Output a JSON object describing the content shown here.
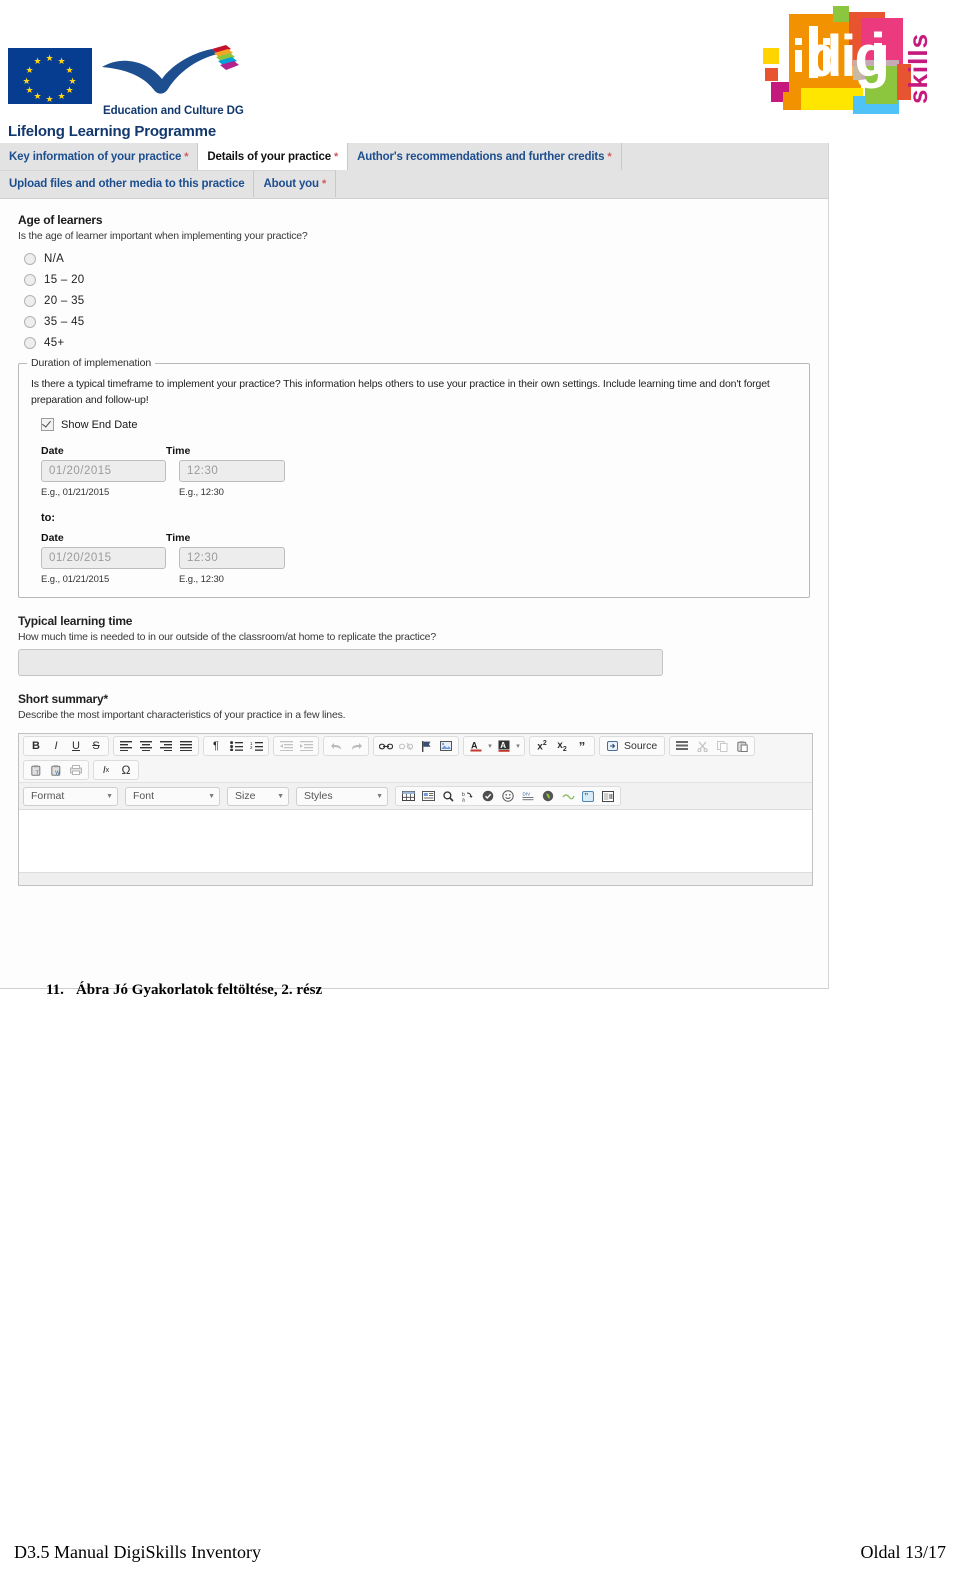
{
  "header": {
    "eu_caption": "Education and Culture DG",
    "llp_caption": "Lifelong Learning Programme",
    "logo_alt": "digi skills"
  },
  "tabs": {
    "row1": [
      {
        "label": "Key information of your practice",
        "required": "*",
        "active": false
      },
      {
        "label": "Details of your practice",
        "required": "*",
        "active": true
      },
      {
        "label": "Author's recommendations and further credits",
        "required": "*",
        "active": false
      }
    ],
    "row2": [
      {
        "label": "Upload files and other media to this practice",
        "required": "",
        "active": false
      },
      {
        "label": "About you",
        "required": "*",
        "active": false
      }
    ]
  },
  "age_section": {
    "title": "Age of learners",
    "help": "Is the age of learner important when implementing your practice?",
    "options": [
      {
        "label": "N/A",
        "selected": false
      },
      {
        "label": "15 – 20",
        "selected": false
      },
      {
        "label": "20 – 35",
        "selected": false
      },
      {
        "label": "35 – 45",
        "selected": false
      },
      {
        "label": "45+",
        "selected": false
      }
    ]
  },
  "duration_section": {
    "legend": "Duration of implemenation",
    "help": "Is there a typical timeframe to implement your practice? This information helps others to use your practice in their own settings. Include learning time and don't forget preparation and follow-up!",
    "show_end_date_label": "Show End Date",
    "show_end_date_checked": true,
    "start": {
      "date_label": "Date",
      "time_label": "Time",
      "date_value": "01/20/2015",
      "time_value": "12:30",
      "date_example": "E.g., 01/21/2015",
      "time_example": "E.g., 12:30"
    },
    "to_label": "to:",
    "end": {
      "date_label": "Date",
      "time_label": "Time",
      "date_value": "01/20/2015",
      "time_value": "12:30",
      "date_example": "E.g., 01/21/2015",
      "time_example": "E.g., 12:30"
    }
  },
  "learning_time_section": {
    "title": "Typical learning time",
    "help": "How much time is needed to in our outside of the classroom/at home to replicate the practice?",
    "value": ""
  },
  "short_summary_section": {
    "title": "Short summary",
    "required": "*",
    "help": "Describe the most important characteristics of your practice in a few lines.",
    "editor_content": ""
  },
  "editor": {
    "row1_icons": [
      "bold-icon",
      "italic-icon",
      "underline-icon",
      "strikethrough-icon",
      "align-left-icon",
      "align-center-icon",
      "align-right-icon",
      "justify-icon",
      "text-direction-rtl-icon",
      "bulleted-list-icon",
      "numbered-list-icon",
      "outdent-icon",
      "indent-icon",
      "undo-icon",
      "redo-icon",
      "link-icon",
      "unlink-icon",
      "anchor-icon",
      "image-icon",
      "text-color-icon",
      "background-color-icon",
      "superscript-icon",
      "subscript-icon",
      "blockquote-icon"
    ],
    "source_label": "Source",
    "row1_tail_icons": [
      "show-blocks-icon",
      "cut-icon",
      "copy-icon",
      "paste-icon"
    ],
    "row2_icons": [
      "paste-text-icon",
      "paste-word-icon",
      "paste-from-word-icon",
      "remove-format-icon",
      "special-character-icon"
    ],
    "combos": [
      {
        "name": "format",
        "label": "Format"
      },
      {
        "name": "font",
        "label": "Font"
      },
      {
        "name": "size",
        "label": "Size"
      },
      {
        "name": "styles",
        "label": "Styles"
      }
    ],
    "row3_icons": [
      "table-icon",
      "div-container-icon",
      "find-icon",
      "replace-icon",
      "spell-check-icon",
      "smiley-icon",
      "page-break-icon",
      "flash-icon",
      "horizontal-rule-icon",
      "quotation-icon",
      "iframe-icon"
    ]
  },
  "figure_caption": {
    "number": "11.",
    "text": "Ábra Jó Gyakorlatok feltöltése, 2. rész"
  },
  "footer": {
    "left": "D3.5 Manual DigiSkills Inventory",
    "right": "Oldal 13/17"
  }
}
